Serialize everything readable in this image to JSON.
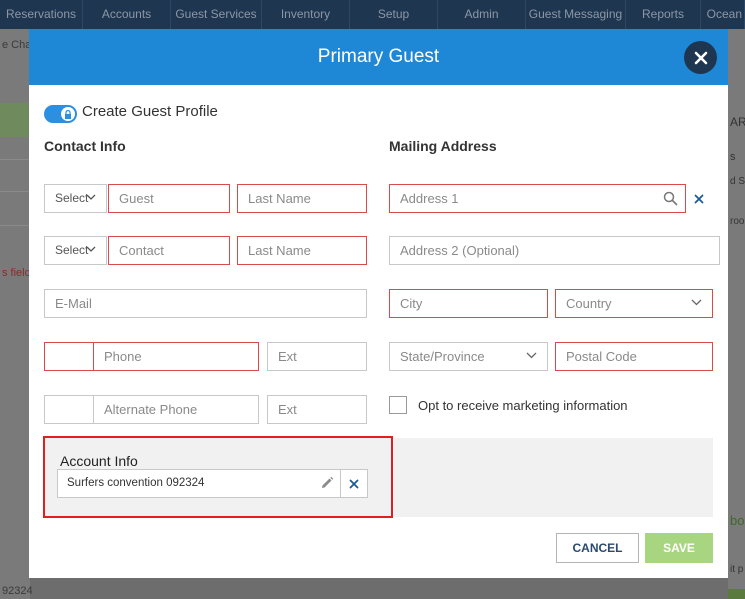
{
  "nav": {
    "items": [
      "Reservations",
      "Accounts",
      "Guest Services",
      "Inventory",
      "Setup",
      "Admin",
      "Guest Messaging",
      "Reports",
      "Ocean"
    ]
  },
  "background": {
    "left_fragments": [
      "e Cha",
      "s field",
      "92324"
    ],
    "right_fragments": [
      "AR",
      "s",
      "d Se",
      "roo",
      "bo",
      "it p"
    ]
  },
  "modal": {
    "title": "Primary Guest",
    "toggle_label": "Create Guest Profile",
    "contact_title": "Contact Info",
    "mailing_title": "Mailing Address",
    "contact": {
      "select1": "Select",
      "guest_placeholder": "Guest",
      "last_name1_placeholder": "Last Name",
      "select2": "Select",
      "contact_placeholder": "Contact",
      "last_name2_placeholder": "Last Name",
      "email_placeholder": "E-Mail",
      "phone_placeholder": "Phone",
      "ext1_placeholder": "Ext",
      "alt_phone_placeholder": "Alternate Phone",
      "ext2_placeholder": "Ext"
    },
    "mailing": {
      "address1_placeholder": "Address 1",
      "address2_placeholder": "Address 2 (Optional)",
      "city_placeholder": "City",
      "country": "Country",
      "state": "State/Province",
      "postal_placeholder": "Postal Code",
      "marketing_label": "Opt to receive marketing information"
    },
    "account": {
      "title": "Account Info",
      "value": "Surfers convention 092324"
    },
    "buttons": {
      "cancel": "CANCEL",
      "save": "SAVE"
    }
  },
  "colors": {
    "header": "#1e88d6",
    "nav": "#1f3650",
    "required_border": "#d94b4b",
    "highlight": "#e02020",
    "save": "#a8d57f"
  }
}
